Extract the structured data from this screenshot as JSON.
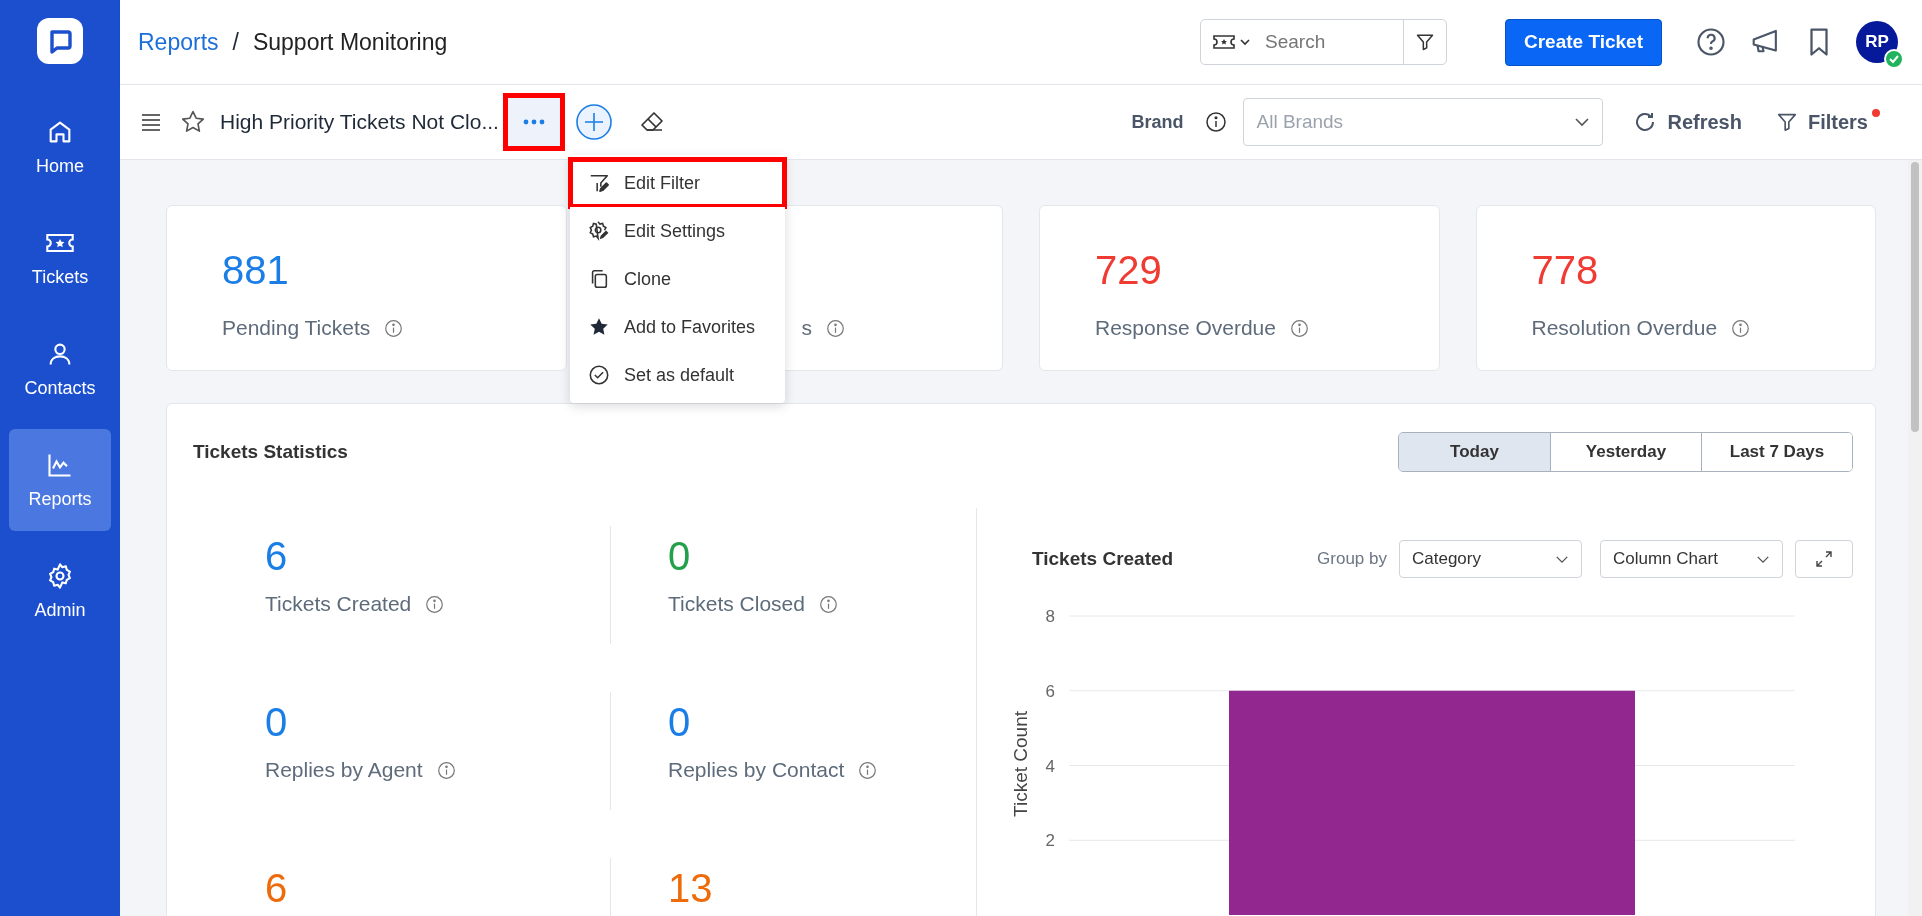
{
  "sidebar": {
    "items": [
      {
        "kind": "home",
        "label": "Home",
        "selected": false
      },
      {
        "kind": "tickets",
        "label": "Tickets",
        "selected": false
      },
      {
        "kind": "contacts",
        "label": "Contacts",
        "selected": false
      },
      {
        "kind": "reports",
        "label": "Reports",
        "selected": true
      },
      {
        "kind": "admin",
        "label": "Admin",
        "selected": false
      }
    ]
  },
  "breadcrumb": {
    "link": "Reports",
    "separator": "/",
    "current": "Support Monitoring"
  },
  "search": {
    "placeholder": "Search"
  },
  "create_button": "Create Ticket",
  "avatar": {
    "initials": "RP",
    "online": true
  },
  "report": {
    "title": "High Priority Tickets Not Clo...",
    "favorite": false,
    "more_highlighted": true
  },
  "brand": {
    "label": "Brand",
    "placeholder": "All Brands"
  },
  "refresh": "Refresh",
  "filters": {
    "label": "Filters",
    "active": true
  },
  "menu": {
    "items": [
      {
        "kind": "filter",
        "label": "Edit Filter",
        "highlighted": true
      },
      {
        "kind": "settings",
        "label": "Edit Settings",
        "highlighted": false
      },
      {
        "kind": "clone",
        "label": "Clone",
        "highlighted": false
      },
      {
        "kind": "star",
        "label": "Add to Favorites",
        "highlighted": false
      },
      {
        "kind": "check",
        "label": "Set as default",
        "highlighted": false
      }
    ]
  },
  "cards": [
    {
      "value": "881",
      "label": "Pending Tickets",
      "color": "#1a7ee6"
    },
    {
      "label": "s"
    },
    {
      "value": "729",
      "label": "Response Overdue",
      "color": "#ef3b32"
    },
    {
      "value": "778",
      "label": "Resolution Overdue",
      "color": "#ef3b32"
    }
  ],
  "statistics": {
    "title": "Tickets Statistics",
    "ranges": [
      {
        "label": "Today",
        "selected": true
      },
      {
        "label": "Yesterday",
        "selected": false
      },
      {
        "label": "Last 7 Days",
        "selected": false
      }
    ],
    "stats": [
      {
        "value": "6",
        "label": "Tickets Created",
        "color": "#1a7ee6"
      },
      {
        "value": "0",
        "label": "Tickets Closed",
        "color": "#22a04b"
      },
      {
        "value": "0",
        "label": "Replies by Agent",
        "color": "#1a7ee6"
      },
      {
        "value": "0",
        "label": "Replies by Contact",
        "color": "#1a7ee6"
      },
      {
        "value": "6",
        "color": "#ee6b0c"
      },
      {
        "value": "13",
        "color": "#ee6b0c"
      }
    ]
  },
  "chart": {
    "title": "Tickets Created",
    "group_by_label": "Group by",
    "group_by": "Category",
    "chart_type": "Column Chart",
    "chart_data": {
      "type": "bar",
      "grid": true,
      "ylabel": "Ticket Count",
      "ylim": [
        0,
        8
      ],
      "yticks": [
        2,
        4,
        6,
        8
      ],
      "series": [
        {
          "color": "#92278f",
          "values": [
            6
          ]
        }
      ]
    }
  }
}
